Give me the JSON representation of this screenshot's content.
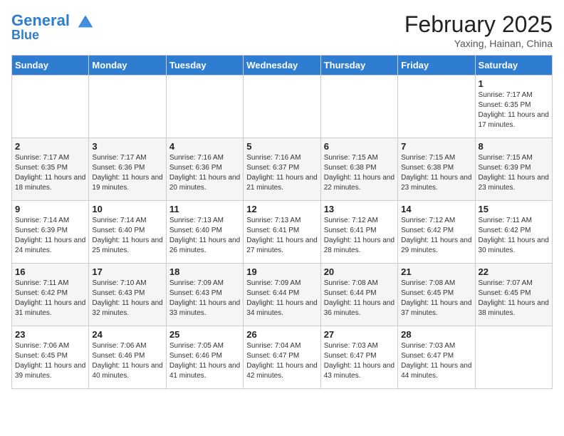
{
  "header": {
    "logo_line1": "General",
    "logo_line2": "Blue",
    "month_title": "February 2025",
    "location": "Yaxing, Hainan, China"
  },
  "days_of_week": [
    "Sunday",
    "Monday",
    "Tuesday",
    "Wednesday",
    "Thursday",
    "Friday",
    "Saturday"
  ],
  "weeks": [
    [
      {
        "day": "",
        "info": ""
      },
      {
        "day": "",
        "info": ""
      },
      {
        "day": "",
        "info": ""
      },
      {
        "day": "",
        "info": ""
      },
      {
        "day": "",
        "info": ""
      },
      {
        "day": "",
        "info": ""
      },
      {
        "day": "1",
        "info": "Sunrise: 7:17 AM\nSunset: 6:35 PM\nDaylight: 11 hours and 17 minutes."
      }
    ],
    [
      {
        "day": "2",
        "info": "Sunrise: 7:17 AM\nSunset: 6:35 PM\nDaylight: 11 hours and 18 minutes."
      },
      {
        "day": "3",
        "info": "Sunrise: 7:17 AM\nSunset: 6:36 PM\nDaylight: 11 hours and 19 minutes."
      },
      {
        "day": "4",
        "info": "Sunrise: 7:16 AM\nSunset: 6:36 PM\nDaylight: 11 hours and 20 minutes."
      },
      {
        "day": "5",
        "info": "Sunrise: 7:16 AM\nSunset: 6:37 PM\nDaylight: 11 hours and 21 minutes."
      },
      {
        "day": "6",
        "info": "Sunrise: 7:15 AM\nSunset: 6:38 PM\nDaylight: 11 hours and 22 minutes."
      },
      {
        "day": "7",
        "info": "Sunrise: 7:15 AM\nSunset: 6:38 PM\nDaylight: 11 hours and 23 minutes."
      },
      {
        "day": "8",
        "info": "Sunrise: 7:15 AM\nSunset: 6:39 PM\nDaylight: 11 hours and 23 minutes."
      }
    ],
    [
      {
        "day": "9",
        "info": "Sunrise: 7:14 AM\nSunset: 6:39 PM\nDaylight: 11 hours and 24 minutes."
      },
      {
        "day": "10",
        "info": "Sunrise: 7:14 AM\nSunset: 6:40 PM\nDaylight: 11 hours and 25 minutes."
      },
      {
        "day": "11",
        "info": "Sunrise: 7:13 AM\nSunset: 6:40 PM\nDaylight: 11 hours and 26 minutes."
      },
      {
        "day": "12",
        "info": "Sunrise: 7:13 AM\nSunset: 6:41 PM\nDaylight: 11 hours and 27 minutes."
      },
      {
        "day": "13",
        "info": "Sunrise: 7:12 AM\nSunset: 6:41 PM\nDaylight: 11 hours and 28 minutes."
      },
      {
        "day": "14",
        "info": "Sunrise: 7:12 AM\nSunset: 6:42 PM\nDaylight: 11 hours and 29 minutes."
      },
      {
        "day": "15",
        "info": "Sunrise: 7:11 AM\nSunset: 6:42 PM\nDaylight: 11 hours and 30 minutes."
      }
    ],
    [
      {
        "day": "16",
        "info": "Sunrise: 7:11 AM\nSunset: 6:42 PM\nDaylight: 11 hours and 31 minutes."
      },
      {
        "day": "17",
        "info": "Sunrise: 7:10 AM\nSunset: 6:43 PM\nDaylight: 11 hours and 32 minutes."
      },
      {
        "day": "18",
        "info": "Sunrise: 7:09 AM\nSunset: 6:43 PM\nDaylight: 11 hours and 33 minutes."
      },
      {
        "day": "19",
        "info": "Sunrise: 7:09 AM\nSunset: 6:44 PM\nDaylight: 11 hours and 34 minutes."
      },
      {
        "day": "20",
        "info": "Sunrise: 7:08 AM\nSunset: 6:44 PM\nDaylight: 11 hours and 36 minutes."
      },
      {
        "day": "21",
        "info": "Sunrise: 7:08 AM\nSunset: 6:45 PM\nDaylight: 11 hours and 37 minutes."
      },
      {
        "day": "22",
        "info": "Sunrise: 7:07 AM\nSunset: 6:45 PM\nDaylight: 11 hours and 38 minutes."
      }
    ],
    [
      {
        "day": "23",
        "info": "Sunrise: 7:06 AM\nSunset: 6:45 PM\nDaylight: 11 hours and 39 minutes."
      },
      {
        "day": "24",
        "info": "Sunrise: 7:06 AM\nSunset: 6:46 PM\nDaylight: 11 hours and 40 minutes."
      },
      {
        "day": "25",
        "info": "Sunrise: 7:05 AM\nSunset: 6:46 PM\nDaylight: 11 hours and 41 minutes."
      },
      {
        "day": "26",
        "info": "Sunrise: 7:04 AM\nSunset: 6:47 PM\nDaylight: 11 hours and 42 minutes."
      },
      {
        "day": "27",
        "info": "Sunrise: 7:03 AM\nSunset: 6:47 PM\nDaylight: 11 hours and 43 minutes."
      },
      {
        "day": "28",
        "info": "Sunrise: 7:03 AM\nSunset: 6:47 PM\nDaylight: 11 hours and 44 minutes."
      },
      {
        "day": "",
        "info": ""
      }
    ]
  ]
}
